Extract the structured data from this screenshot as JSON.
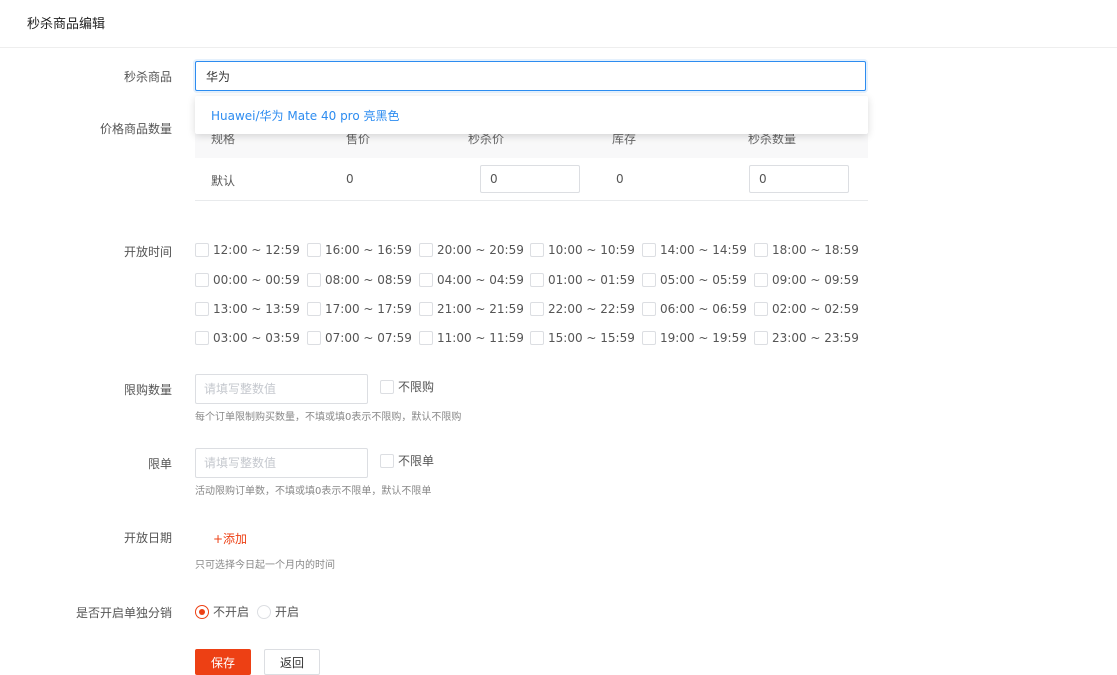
{
  "header": {
    "title": "秒杀商品编辑"
  },
  "product": {
    "label": "秒杀商品",
    "search_value": "华为",
    "dropdown_option": "Huawei/华为 Mate 40 pro 亮黑色"
  },
  "specs": {
    "label": "价格商品数量",
    "columns": [
      "规格",
      "售价",
      "秒杀价",
      "库存",
      "秒杀数量"
    ],
    "row": {
      "spec": "默认",
      "price": "0",
      "seckill_price": "0",
      "stock": "0",
      "seckill_qty": "0"
    }
  },
  "time_slots": {
    "label": "开放时间",
    "rows": [
      [
        "12:00 ~ 12:59",
        "16:00 ~ 16:59",
        "20:00 ~ 20:59",
        "10:00 ~ 10:59",
        "14:00 ~ 14:59",
        "18:00 ~ 18:59"
      ],
      [
        "00:00 ~ 00:59",
        "08:00 ~ 08:59",
        "04:00 ~ 04:59",
        "01:00 ~ 01:59",
        "05:00 ~ 05:59",
        "09:00 ~ 09:59"
      ],
      [
        "13:00 ~ 13:59",
        "17:00 ~ 17:59",
        "21:00 ~ 21:59",
        "22:00 ~ 22:59",
        "06:00 ~ 06:59",
        "02:00 ~ 02:59"
      ],
      [
        "03:00 ~ 03:59",
        "07:00 ~ 07:59",
        "11:00 ~ 11:59",
        "15:00 ~ 15:59",
        "19:00 ~ 19:59",
        "23:00 ~ 23:59"
      ]
    ]
  },
  "purchase_limit": {
    "label": "限购数量",
    "placeholder": "请填写整数值",
    "checkbox_label": "不限购",
    "hint": "每个订单限制购买数量，不填或填0表示不限购，默认不限购"
  },
  "order_limit": {
    "label": "限单",
    "placeholder": "请填写整数值",
    "checkbox_label": "不限单",
    "hint": "活动限购订单数，不填或填0表示不限单，默认不限单"
  },
  "open_date": {
    "label": "开放日期",
    "add_label": "+添加",
    "hint": "只可选择今日起一个月内的时间"
  },
  "distribution": {
    "label": "是否开启单独分销",
    "options": [
      "不开启",
      "开启"
    ],
    "selected": "不开启"
  },
  "actions": {
    "save_label": "保存",
    "back_label": "返回"
  },
  "colors": {
    "accent": "#ed4014",
    "link": "#2d8cf0"
  }
}
